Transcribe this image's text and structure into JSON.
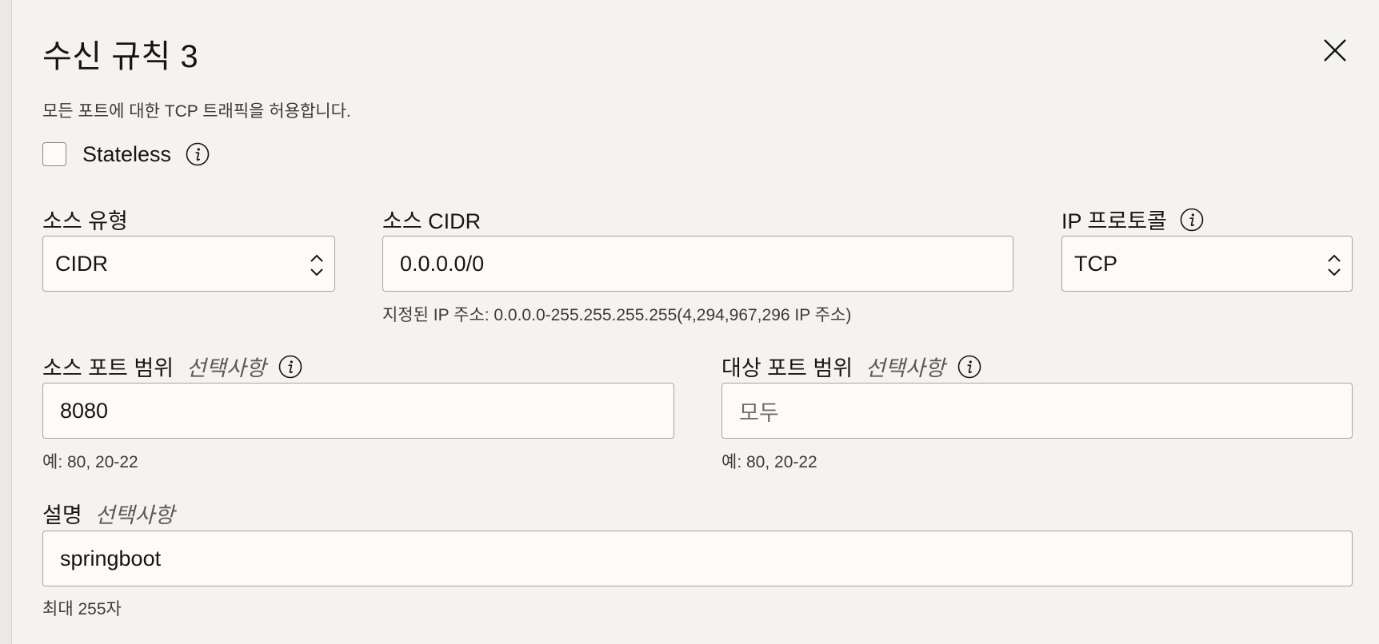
{
  "dialog": {
    "title": "수신 규칙 3",
    "description": "모든 포트에 대한 TCP 트래픽을 허용합니다."
  },
  "stateless": {
    "label": "Stateless",
    "checked": false
  },
  "source_type": {
    "label": "소스 유형",
    "value": "CIDR"
  },
  "source_cidr": {
    "label": "소스 CIDR",
    "value": "0.0.0.0/0",
    "hint": "지정된 IP 주소: 0.0.0.0-255.255.255.255(4,294,967,296 IP 주소)"
  },
  "ip_protocol": {
    "label": "IP 프로토콜",
    "value": "TCP"
  },
  "source_port_range": {
    "label": "소스 포트 범위",
    "optional": "선택사항",
    "value": "8080",
    "hint": "예: 80, 20-22"
  },
  "destination_port_range": {
    "label": "대상 포트 범위",
    "optional": "선택사항",
    "placeholder": "모두",
    "hint": "예: 80, 20-22"
  },
  "description_field": {
    "label": "설명",
    "optional": "선택사항",
    "value": "springboot",
    "hint": "최대 255자"
  },
  "icons": {
    "close": "close-icon",
    "info": "info-icon",
    "chevrons": "chevron-up-down-icon"
  }
}
